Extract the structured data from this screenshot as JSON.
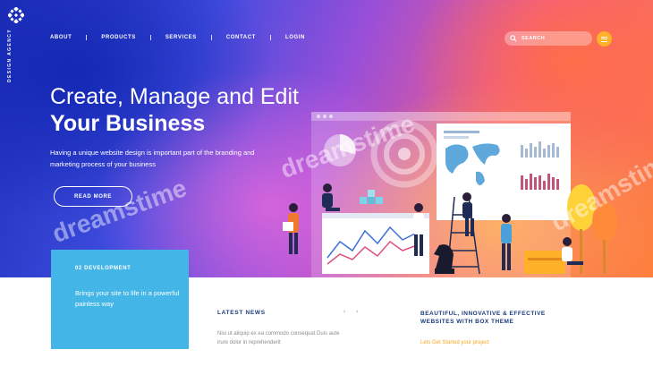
{
  "brand": {
    "vertical_text": "DESIGN AGENCY"
  },
  "nav": {
    "items": [
      "ABOUT",
      "PRODUCTS",
      "SERVICES",
      "CONTACT",
      "LOGIN"
    ]
  },
  "search": {
    "placeholder": "SEARCH"
  },
  "hero": {
    "headline_line1": "Create, Manage and Edit",
    "headline_line2": "Your Business",
    "description": "Having a unique website design is important part of the branding and marketing process of your business",
    "read_more_label": "READ MORE"
  },
  "development_card": {
    "tag": "02  DEVELOPMENT",
    "text": "Brings your site to life in a powerful painless way"
  },
  "latest_news": {
    "title": "LATEST NEWS",
    "prev_arrow": "‹",
    "next_arrow": "›",
    "text": "Nisi ut aliquip ex ea commodo consequat Duis aute irure dolor in reprehenderit"
  },
  "feature": {
    "title": "BEAUTIFUL, INNOVATIVE & EFFECTIVE WEBSITES WITH BOX THEME",
    "link": "Lets Get Started your project"
  },
  "watermarks": [
    "dreamstime",
    "dreamstime",
    "dreamstime"
  ],
  "colors": {
    "accent_blue": "#43b5e6",
    "accent_orange": "#ffb12a",
    "navy_text": "#1a3a7c",
    "link_orange": "#f5a623"
  }
}
